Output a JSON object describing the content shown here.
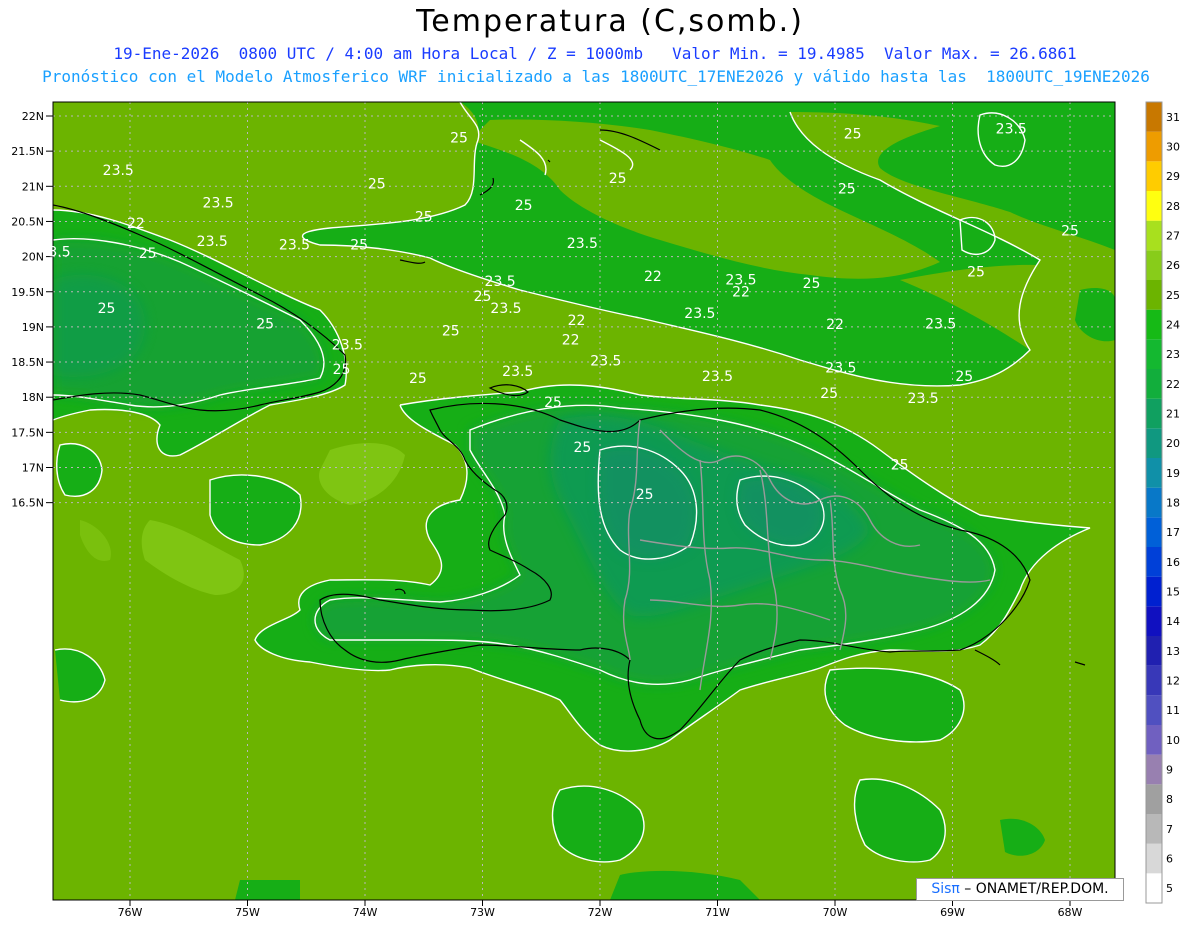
{
  "header": {
    "title": "Temperatura (C,somb.)",
    "line1": "19-Ene-2026  0800 UTC / 4:00 am Hora Local / Z = 1000mb   Valor Min. = 19.4985  Valor Max. = 26.6861",
    "line2": "Pronóstico con el Modelo Atmosferico WRF inicializado a las 1800UTC_17ENE2026 y válido hasta las  1800UTC_19ENE2026"
  },
  "axes": {
    "lat_labels": [
      "22N",
      "21.5N",
      "21N",
      "20.5N",
      "20N",
      "19.5N",
      "19N",
      "18.5N",
      "18N",
      "17.5N",
      "17N",
      "16.5N"
    ],
    "lon_labels": [
      "76W",
      "75W",
      "74W",
      "73W",
      "72W",
      "71W",
      "70W",
      "69W",
      "68W"
    ]
  },
  "colorbar": {
    "levels": [
      "5",
      "6",
      "7",
      "8",
      "9",
      "10",
      "11",
      "12",
      "13",
      "14",
      "15",
      "16",
      "17",
      "18",
      "19",
      "20",
      "21",
      "22",
      "23",
      "24",
      "25",
      "26",
      "27",
      "28",
      "29",
      "30",
      "31"
    ],
    "colors": [
      "#ffffff",
      "#d8d8d8",
      "#b8b8b8",
      "#a0a0a0",
      "#9880b0",
      "#7060c0",
      "#5050c0",
      "#3838b8",
      "#2020b0",
      "#1010c0",
      "#0020d0",
      "#0040d8",
      "#0060d8",
      "#0878c8",
      "#1090a8",
      "#109880",
      "#10a060",
      "#12ae3c",
      "#14b830",
      "#16ba16",
      "#6cb400",
      "#88cc1a",
      "#a8e01e",
      "#ffff10",
      "#ffcc00",
      "#ee9c00",
      "#c87800"
    ]
  },
  "contour_labels": [
    {
      "text": "25",
      "lat": 21.68,
      "lon": -69.85
    },
    {
      "text": "23.5",
      "lat": 21.75,
      "lon": -68.5
    },
    {
      "text": "25",
      "lat": 21.62,
      "lon": -73.2
    },
    {
      "text": "23.5",
      "lat": 21.16,
      "lon": -76.1
    },
    {
      "text": "25",
      "lat": 20.97,
      "lon": -73.9
    },
    {
      "text": "25",
      "lat": 21.05,
      "lon": -71.85
    },
    {
      "text": "25",
      "lat": 20.9,
      "lon": -69.9
    },
    {
      "text": "23.5",
      "lat": 20.7,
      "lon": -75.25
    },
    {
      "text": "25",
      "lat": 20.66,
      "lon": -72.65
    },
    {
      "text": "25",
      "lat": 20.5,
      "lon": -73.5
    },
    {
      "text": "22",
      "lat": 20.41,
      "lon": -75.95
    },
    {
      "text": "25",
      "lat": 20.3,
      "lon": -68.0
    },
    {
      "text": "23.5",
      "lat": 20.15,
      "lon": -75.3
    },
    {
      "text": "23.5",
      "lat": 20.1,
      "lon": -74.6
    },
    {
      "text": "25",
      "lat": 20.1,
      "lon": -74.05
    },
    {
      "text": "23.5",
      "lat": 20.12,
      "lon": -72.15
    },
    {
      "text": "3.5",
      "lat": 20.0,
      "lon": -76.6
    },
    {
      "text": "25",
      "lat": 19.98,
      "lon": -75.85
    },
    {
      "text": "25",
      "lat": 19.72,
      "lon": -68.8
    },
    {
      "text": "22",
      "lat": 19.65,
      "lon": -71.55
    },
    {
      "text": "23.5",
      "lat": 19.58,
      "lon": -72.85
    },
    {
      "text": "23.5",
      "lat": 19.6,
      "lon": -70.8
    },
    {
      "text": "25",
      "lat": 19.55,
      "lon": -70.2
    },
    {
      "text": "22",
      "lat": 19.43,
      "lon": -70.8
    },
    {
      "text": "25",
      "lat": 19.37,
      "lon": -73.0
    },
    {
      "text": "25",
      "lat": 19.2,
      "lon": -76.2
    },
    {
      "text": "23.5",
      "lat": 19.2,
      "lon": -72.8
    },
    {
      "text": "23.5",
      "lat": 19.13,
      "lon": -71.15
    },
    {
      "text": "22",
      "lat": 19.03,
      "lon": -72.2
    },
    {
      "text": "22",
      "lat": 18.97,
      "lon": -70.0
    },
    {
      "text": "25",
      "lat": 18.98,
      "lon": -74.85
    },
    {
      "text": "23.5",
      "lat": 18.98,
      "lon": -69.1
    },
    {
      "text": "25",
      "lat": 18.88,
      "lon": -73.27
    },
    {
      "text": "22",
      "lat": 18.75,
      "lon": -72.25
    },
    {
      "text": "23.5",
      "lat": 18.68,
      "lon": -74.15
    },
    {
      "text": "23.5",
      "lat": 18.45,
      "lon": -71.95
    },
    {
      "text": "23.5",
      "lat": 18.35,
      "lon": -69.95
    },
    {
      "text": "25",
      "lat": 18.33,
      "lon": -74.2
    },
    {
      "text": "23.5",
      "lat": 18.3,
      "lon": -72.7
    },
    {
      "text": "25",
      "lat": 18.2,
      "lon": -73.55
    },
    {
      "text": "23.5",
      "lat": 18.23,
      "lon": -71.0
    },
    {
      "text": "25",
      "lat": 18.23,
      "lon": -68.9
    },
    {
      "text": "25",
      "lat": 17.99,
      "lon": -70.05
    },
    {
      "text": "23.5",
      "lat": 17.92,
      "lon": -69.25
    },
    {
      "text": "25",
      "lat": 17.86,
      "lon": -72.4
    },
    {
      "text": "25",
      "lat": 17.22,
      "lon": -72.15
    },
    {
      "text": "25",
      "lat": 16.97,
      "lon": -69.45
    },
    {
      "text": "25",
      "lat": 16.55,
      "lon": -71.62
    }
  ],
  "badge": {
    "part1": "Sisπ",
    "part2": " – ONAMET/REP.DOM."
  }
}
